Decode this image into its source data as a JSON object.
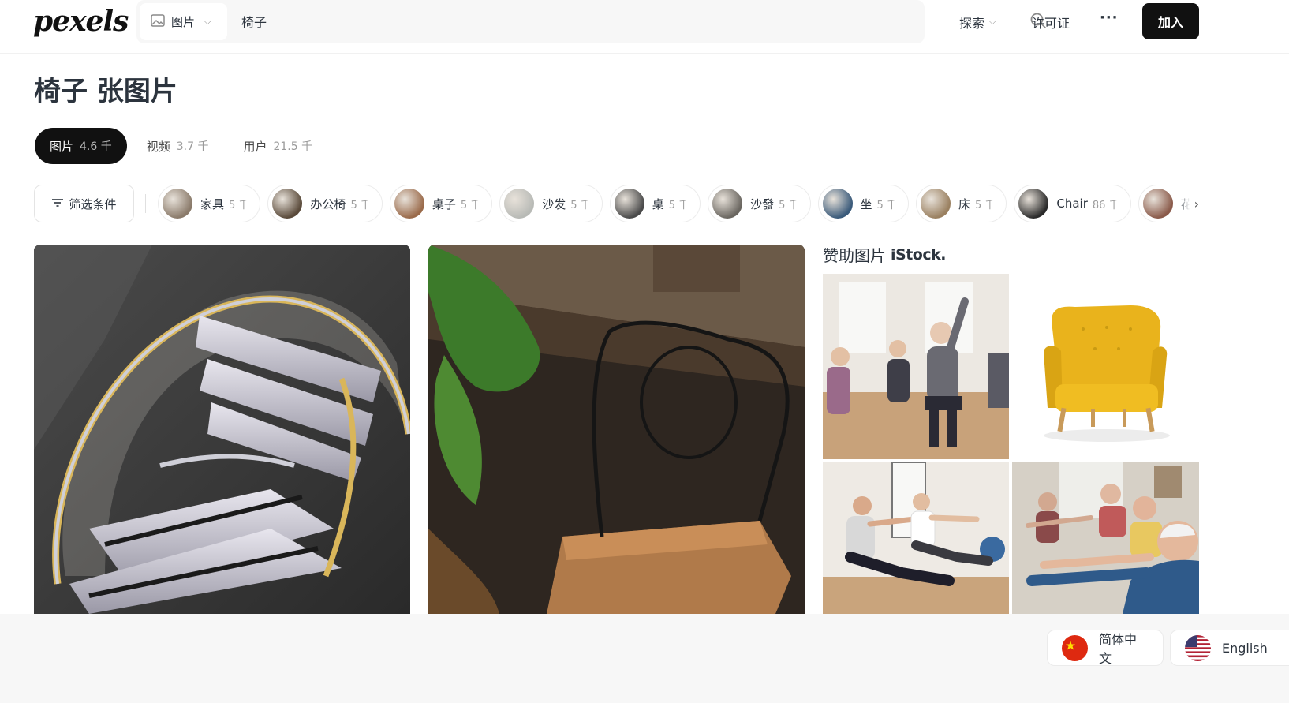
{
  "header": {
    "logo": "pexels",
    "search_type": "图片",
    "search_query": "椅子",
    "nav_explore": "探索",
    "nav_license": "许可证",
    "nav_more": "···",
    "join": "加入"
  },
  "page_title": "椅子 张图片",
  "tabs": [
    {
      "label": "图片",
      "count": "4.6 千",
      "active": true
    },
    {
      "label": "视频",
      "count": "3.7 千",
      "active": false
    },
    {
      "label": "用户",
      "count": "21.5 千",
      "active": false
    }
  ],
  "filter_label": "筛选条件",
  "chips": [
    {
      "label": "家具",
      "count": "5 千",
      "color": "#8a7a6a"
    },
    {
      "label": "办公椅",
      "count": "5 千",
      "color": "#5a4a3a"
    },
    {
      "label": "桌子",
      "count": "5 千",
      "color": "#9a6a4a"
    },
    {
      "label": "沙发",
      "count": "5 千",
      "color": "#b8bab6"
    },
    {
      "label": "桌",
      "count": "5 千",
      "color": "#4a4a4a"
    },
    {
      "label": "沙發",
      "count": "5 千",
      "color": "#6a6660"
    },
    {
      "label": "坐",
      "count": "5 千",
      "color": "#3a5a7a"
    },
    {
      "label": "床",
      "count": "5 千",
      "color": "#9a8060"
    },
    {
      "label": "Chair",
      "count": "86 千",
      "color": "#2a2a2a"
    },
    {
      "label": "花",
      "count": "",
      "color": "#8a5a4a"
    }
  ],
  "sponsor": {
    "title": "赞助图片",
    "brand": "iStock."
  },
  "languages": [
    {
      "label": "简体中文",
      "flag": "cn"
    },
    {
      "label": "English",
      "flag": "us"
    }
  ],
  "colors": {
    "accent": "#111111",
    "text": "#2c343e",
    "muted": "#9a9a9a"
  }
}
